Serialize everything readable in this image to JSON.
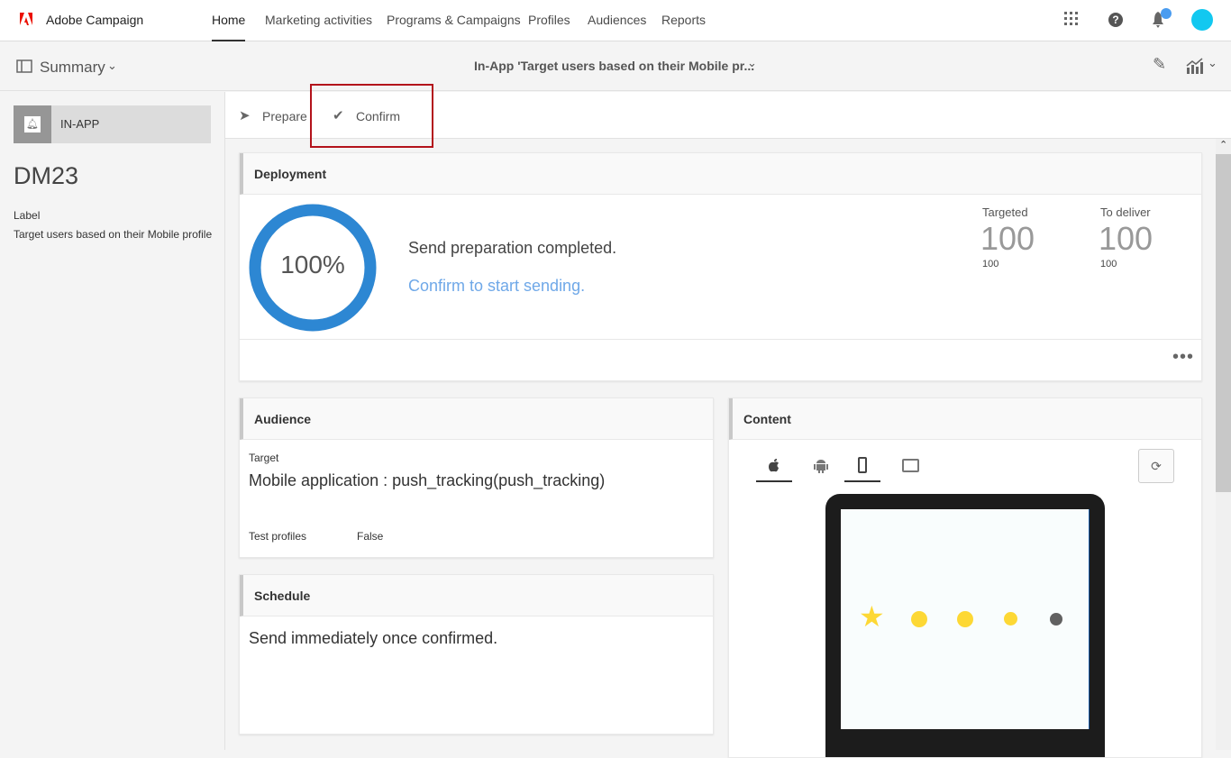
{
  "app": {
    "name": "Adobe Campaign"
  },
  "nav": [
    {
      "label": "Home"
    },
    {
      "label": "Marketing activities"
    },
    {
      "label": "Programs & Campaigns"
    },
    {
      "label": "Profiles"
    },
    {
      "label": "Audiences"
    },
    {
      "label": "Reports"
    }
  ],
  "subbar": {
    "summary": "Summary",
    "title": "In-App 'Target users based on their Mobile pr..."
  },
  "left": {
    "type": "IN-APP",
    "id": "DM23",
    "label_heading": "Label",
    "label_value": "Target users based on their Mobile profile"
  },
  "tabs": [
    {
      "label": "Prepare"
    },
    {
      "label": "Confirm"
    }
  ],
  "deployment": {
    "title": "Deployment",
    "progress_percent": 100,
    "progress_text": "100%",
    "status": "Send preparation completed.",
    "confirm_link": "Confirm to start sending.",
    "stats": [
      {
        "label": "Targeted",
        "value": "100",
        "sub": "100"
      },
      {
        "label": "To deliver",
        "value": "100",
        "sub": "100"
      }
    ]
  },
  "audience": {
    "title": "Audience",
    "target_label": "Target",
    "target_value": "Mobile application : push_tracking(push_tracking)",
    "test_label": "Test profiles",
    "test_value": "False"
  },
  "schedule": {
    "title": "Schedule",
    "text": "Send immediately once confirmed."
  },
  "content": {
    "title": "Content"
  },
  "colors": {
    "accent": "#2d87d3",
    "link": "#6fa8e8",
    "highlight": "#b3121b",
    "star": "#fdd835"
  }
}
